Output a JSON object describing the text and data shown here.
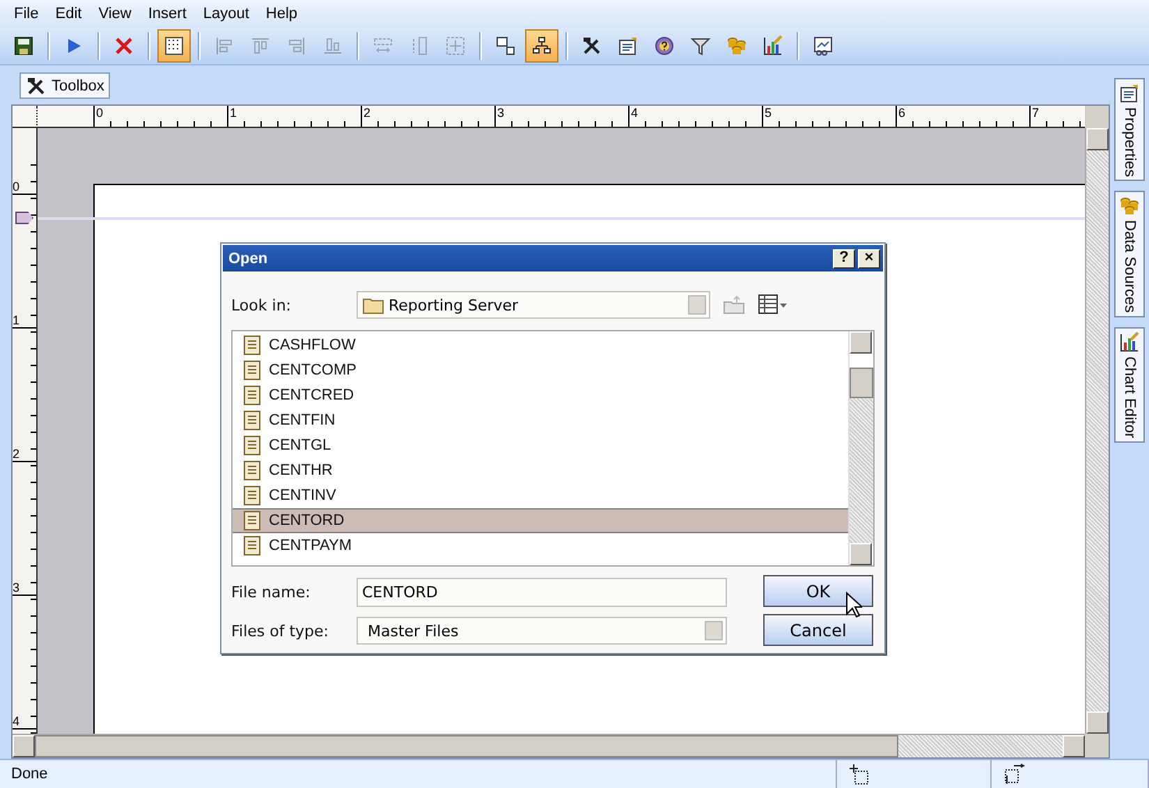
{
  "menu": [
    "File",
    "Edit",
    "View",
    "Insert",
    "Layout",
    "Help"
  ],
  "toolbar": [
    [
      {
        "kind": "save",
        "active": false,
        "disabled": false
      }
    ],
    [
      {
        "kind": "run",
        "active": false,
        "disabled": false
      }
    ],
    [
      {
        "kind": "delete",
        "active": false,
        "disabled": false
      }
    ],
    [
      {
        "kind": "grid",
        "active": true,
        "disabled": false
      }
    ],
    [
      {
        "kind": "align-left",
        "active": false,
        "disabled": true
      },
      {
        "kind": "align-top",
        "active": false,
        "disabled": true
      },
      {
        "kind": "align-right",
        "active": false,
        "disabled": true
      },
      {
        "kind": "align-bottom",
        "active": false,
        "disabled": true
      }
    ],
    [
      {
        "kind": "same-height",
        "active": false,
        "disabled": true
      },
      {
        "kind": "same-width",
        "active": false,
        "disabled": true
      },
      {
        "kind": "same-size",
        "active": false,
        "disabled": true
      }
    ],
    [
      {
        "kind": "layers",
        "active": false,
        "disabled": false
      },
      {
        "kind": "tree",
        "active": true,
        "disabled": false
      }
    ],
    [
      {
        "kind": "tools",
        "active": false,
        "disabled": false
      },
      {
        "kind": "properties",
        "active": false,
        "disabled": false
      },
      {
        "kind": "help",
        "active": false,
        "disabled": false
      },
      {
        "kind": "filter",
        "active": false,
        "disabled": false
      },
      {
        "kind": "database",
        "active": false,
        "disabled": false
      },
      {
        "kind": "chart",
        "active": false,
        "disabled": false
      }
    ],
    [
      {
        "kind": "preview",
        "active": false,
        "disabled": false
      }
    ]
  ],
  "toolbox_tab": {
    "label": "Toolbox"
  },
  "ruler": {
    "h_labels": [
      "0",
      "1",
      "2",
      "3",
      "4",
      "5",
      "6",
      "7"
    ],
    "v_labels": [
      "0",
      "1",
      "2",
      "3",
      "4"
    ]
  },
  "side_tabs": [
    {
      "kind": "properties",
      "label": "Properties"
    },
    {
      "kind": "database",
      "label": "Data Sources"
    },
    {
      "kind": "chart",
      "label": "Chart Editor"
    }
  ],
  "dialog": {
    "title": "Open",
    "help_button": "?",
    "close_button": "×",
    "look_in_label": "Look in:",
    "look_in_value": "Reporting Server",
    "files": [
      {
        "name": "CASHFLOW",
        "selected": false
      },
      {
        "name": "CENTCOMP",
        "selected": false
      },
      {
        "name": "CENTCRED",
        "selected": false
      },
      {
        "name": "CENTFIN",
        "selected": false
      },
      {
        "name": "CENTGL",
        "selected": false
      },
      {
        "name": "CENTHR",
        "selected": false
      },
      {
        "name": "CENTINV",
        "selected": false
      },
      {
        "name": "CENTORD",
        "selected": true
      },
      {
        "name": "CENTPAYM",
        "selected": false
      }
    ],
    "file_name_label": "File name:",
    "file_name_value": "CENTORD",
    "files_of_type_label": "Files of type:",
    "files_of_type_value": "Master Files",
    "ok_button": "OK",
    "cancel_button": "Cancel"
  },
  "status_bar": {
    "text": "Done"
  }
}
